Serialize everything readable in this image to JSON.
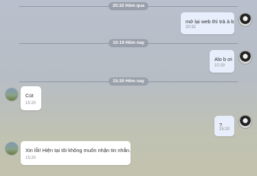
{
  "dividers": [
    "20:32 Hôm qua",
    "10:19 Hôm nay",
    "15:20 Hôm nay"
  ],
  "messages": [
    {
      "text": "mở lại web thì trả à b",
      "time": "20:32",
      "side": "sent"
    },
    {
      "text": "Alo b ơi",
      "time": "10:19",
      "side": "sent"
    },
    {
      "text": "Cút",
      "time": "15:20",
      "side": "received"
    },
    {
      "text": "?",
      "time": "15:20",
      "side": "sent"
    },
    {
      "text": "Xin lỗi! Hiện tại tôi không muốn nhận tin nhắn.",
      "time": "15:20",
      "side": "received"
    }
  ]
}
